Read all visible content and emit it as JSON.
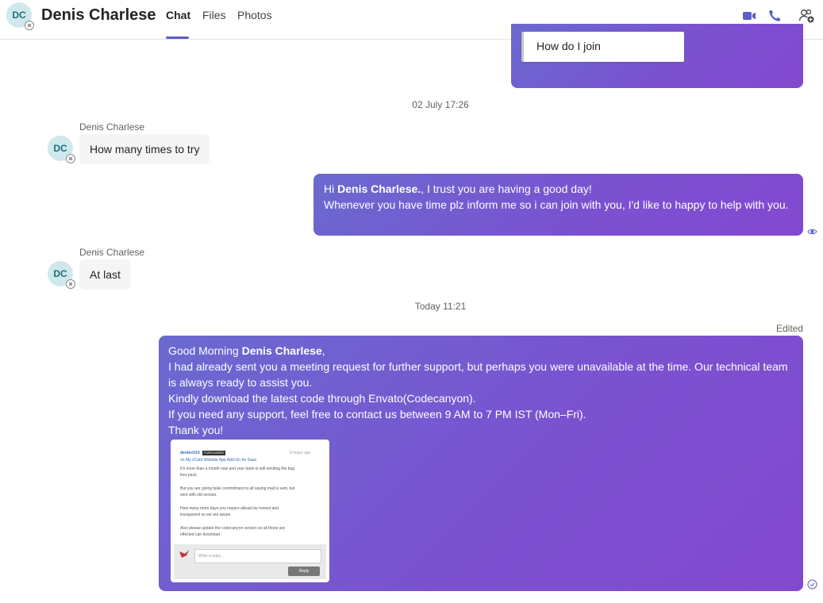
{
  "header": {
    "avatar_initials": "DC",
    "contact_name": "Denis Charlese",
    "tabs": [
      {
        "label": "Chat",
        "active": true
      },
      {
        "label": "Files",
        "active": false
      },
      {
        "label": "Photos",
        "active": false
      }
    ],
    "icons": [
      "video-call-icon",
      "audio-call-icon",
      "add-people-icon"
    ],
    "accent_color": "#5b5fc7"
  },
  "messages": {
    "quoted_reply": "How do I join",
    "time_1": "02 July 17:26",
    "in_1": {
      "sender": "Denis Charlese",
      "avatar": "DC",
      "text": "How many times to try"
    },
    "out_1": {
      "greet": "Hi ",
      "name": "Denis Charlese.",
      "line1_rest": ", I trust you are having a good day!",
      "line2": "Whenever you have time plz inform me so i can join with you, I'd like to happy to help with you."
    },
    "in_2": {
      "sender": "Denis Charlese",
      "avatar": "DC",
      "text": "At last"
    },
    "time_2": "Today 11:21",
    "edited_label": "Edited",
    "out_2": {
      "greet": "Good Morning ",
      "name": "Denis Charlese",
      "greet_end": ",",
      "line2": "I had already sent you a meeting request for further support, but perhaps you were unavailable at the time. Our technical team",
      "line3": "is always ready to assist you.",
      "line4": "Kindly download the latest code through Envato(Codecanyon).",
      "line5": "If you need any support, feel free to contact us between 9 AM to 7 PM IST (Mon–Fri).",
      "line6": "Thank you!"
    },
    "attachment": {
      "author": "dentech10",
      "badge": "PURCHASED",
      "time": "9 hours ago",
      "item": "on My vCard Website App Add-On for Saas",
      "p1a": "It's more than a month now and your team is still sending the bug",
      "p1b": "free pack.",
      "p2a": "But you are giving false commitment to all saying mail is sent, but",
      "p2b": "sent with old version.",
      "p3a": "How many more days you require atleast be honest and",
      "p3b": "transparent so we are aware",
      "p4a": "Also please update the codecanyon version so all those are",
      "p4b": "effected can download",
      "reply_placeholder": "Write a reply...",
      "reply_button": "Reply"
    }
  }
}
